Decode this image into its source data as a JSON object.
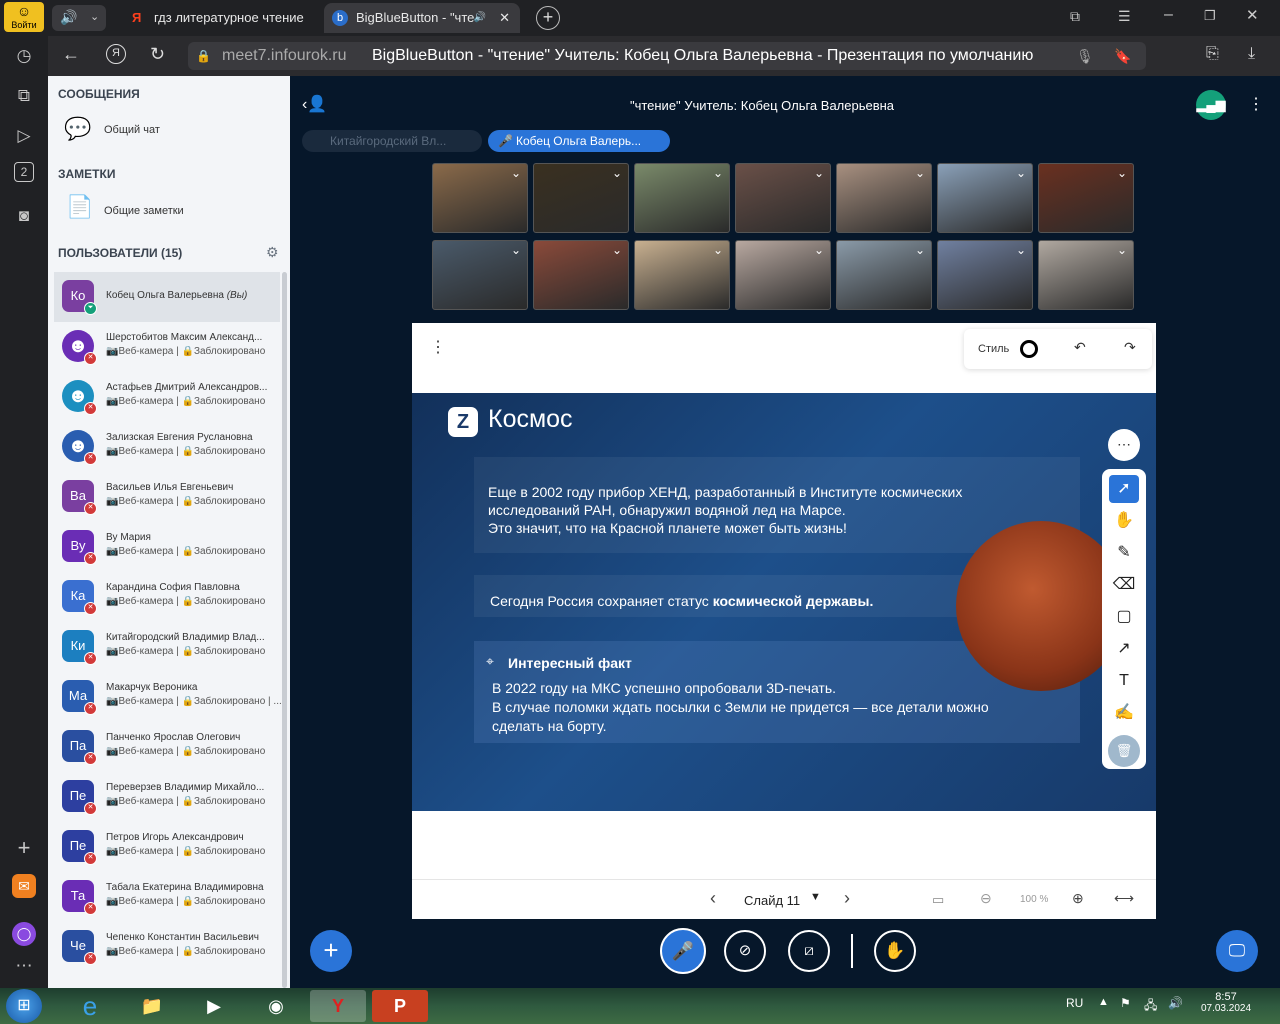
{
  "browser_sidebar": {
    "login_label": "Войти",
    "tab_count_badge": "2"
  },
  "tabs": [
    {
      "title": "гдз литературное чтение"
    },
    {
      "title": "BigBlueButton - \"чте"
    }
  ],
  "address": {
    "domain": "meet7.infourok.ru",
    "page_title": "BigBlueButton - \"чтение\" Учитель: Кобец Ольга Валерьевна - Презентация по умолчанию"
  },
  "left_panel": {
    "messages_header": "СООБЩЕНИЯ",
    "public_chat": "Общий чат",
    "notes_header": "ЗАМЕТКИ",
    "shared_notes": "Общие заметки",
    "users_header": "ПОЛЬЗОВАТЕЛИ (15)",
    "users": [
      {
        "initials": "Ко",
        "name": "Кобец Ольга Валерьевна",
        "suffix": "(Вы)",
        "status": "",
        "color": "#7a3fa0"
      },
      {
        "initials": "☻",
        "name": "Шерстобитов Максим Александ...",
        "status": "📷Веб-камера | 🔒Заблокировано",
        "color": "#6a2db5"
      },
      {
        "initials": "☻",
        "name": "Астафьев Дмитрий Александров...",
        "status": "📷Веб-камера | 🔒Заблокировано",
        "color": "#1c8fc0"
      },
      {
        "initials": "☻",
        "name": "Зализская Евгения Руслановна",
        "status": "📷Веб-камера | 🔒Заблокировано",
        "color": "#2a5db0"
      },
      {
        "initials": "Ва",
        "name": "Васильев Илья Евгеньевич",
        "status": "📷Веб-камера | 🔒Заблокировано",
        "color": "#7a3fa0"
      },
      {
        "initials": "Ву",
        "name": "Ву Мария",
        "status": "📷Веб-камера | 🔒Заблокировано",
        "color": "#6a2db5"
      },
      {
        "initials": "Ка",
        "name": "Карандина София Павловна",
        "status": "📷Веб-камера | 🔒Заблокировано",
        "color": "#3a6fd0"
      },
      {
        "initials": "Ки",
        "name": "Китайгородский Владимир Влад...",
        "status": "📷Веб-камера | 🔒Заблокировано",
        "color": "#1c7fc0"
      },
      {
        "initials": "Ма",
        "name": "Макарчук Вероника",
        "status": "📷Веб-камера | 🔒Заблокировано | ...",
        "color": "#2a5db0"
      },
      {
        "initials": "Па",
        "name": "Панченко Ярослав Олегович",
        "status": "📷Веб-камера | 🔒Заблокировано",
        "color": "#2a4fa0"
      },
      {
        "initials": "Пе",
        "name": "Переверзев Владимир Михайло...",
        "status": "📷Веб-камера | 🔒Заблокировано",
        "color": "#2d3fa0"
      },
      {
        "initials": "Пе",
        "name": "Петров Игорь Александрович",
        "status": "📷Веб-камера | 🔒Заблокировано",
        "color": "#2d3fa0"
      },
      {
        "initials": "Та",
        "name": "Табала Екатерина Владимировна",
        "status": "📷Веб-камера | 🔒Заблокировано",
        "color": "#6a2db5"
      },
      {
        "initials": "Че",
        "name": "Чепенко Константин Васильевич",
        "status": "📷Веб-камера | 🔒Заблокировано",
        "color": "#2a4fa0"
      }
    ]
  },
  "meeting": {
    "title": "\"чтение\" Учитель: Кобец Ольга Валерьевна",
    "talkers": [
      "Китайгородский Вл...",
      "Кобец Ольга Валерь..."
    ],
    "video_tiles": [
      "#8a6a4a",
      "#3a3020",
      "#7a8a6a",
      "#6a5048",
      "#a89080",
      "#8aa0b8",
      "#6a3020",
      "#4a5a6a",
      "#8a4a3a",
      "#c8b090",
      "#b8a8a0",
      "#8a9aa8",
      "#7080a0",
      "#b0a8a0"
    ]
  },
  "slide": {
    "style_label": "Стиль",
    "brand": "Космос",
    "para1": [
      "Еще в 2002 году прибор ХЕНД, разработанный в Институте космических",
      "исследований РАН, обнаружил водяной лед на Марсе.",
      "Это значит, что на Красной планете может быть жизнь!"
    ],
    "para2_plain": "Сегодня Россия сохраняет статус ",
    "para2_bold": "космической державы.",
    "fact_title": "Интересный факт",
    "fact_lines": [
      "В 2022 году на МКС успешно опробовали 3D-печать.",
      "В случае поломки ждать посылки с Земли не придется — все детали можно",
      "сделать на борту."
    ],
    "slide_label": "Слайд 11",
    "zoom": "100 %"
  },
  "taskbar": {
    "lang": "RU",
    "time": "8:57",
    "date": "07.03.2024"
  }
}
